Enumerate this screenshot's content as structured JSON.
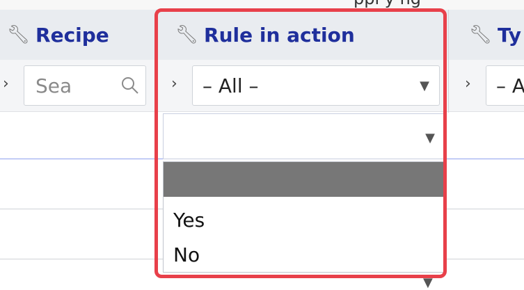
{
  "top_strip_text": "ppl   y   ng",
  "columns": [
    {
      "title": "Recipe"
    },
    {
      "title": "Rule in action"
    },
    {
      "title": "Ty"
    }
  ],
  "filters": {
    "recipe": {
      "placeholder": "Sea"
    },
    "rule_in_action": {
      "value": "– All –"
    },
    "type": {
      "value": "– A"
    }
  },
  "dropdown": {
    "current_value": "",
    "options": [
      "",
      "Yes",
      "No"
    ],
    "selected_index": 0
  },
  "colors": {
    "header_title": "#1f2f9c",
    "highlight": "#e8404a",
    "selected_option": "#777777"
  },
  "icons": [
    "wrench-icon",
    "chevron-right-icon",
    "search-icon",
    "caret-down-icon"
  ]
}
